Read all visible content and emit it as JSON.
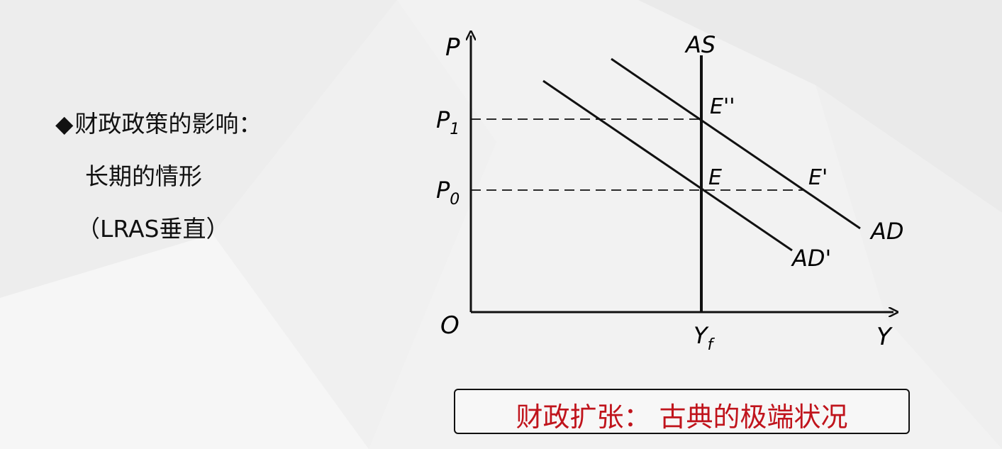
{
  "bullet": {
    "marker": "◆",
    "line1": "财政政策的影响：",
    "line2": "长期的情形",
    "line3": "（LRAS垂直）"
  },
  "diagram": {
    "axis_y_label": "P",
    "axis_x_label": "Y",
    "origin_label": "O",
    "as_label": "AS",
    "p1_label": "P",
    "p1_sub": "1",
    "p0_label": "P",
    "p0_sub": "0",
    "yf_label": "Y",
    "yf_sub": "f",
    "e2_label": "E''",
    "e_label": "E",
    "e1_label": "E'",
    "ad_label": "AD",
    "ad1_label": "AD'"
  },
  "caption": "财政扩张： 古典的极端状况",
  "colors": {
    "caption": "#c0141c",
    "line": "#111111"
  }
}
